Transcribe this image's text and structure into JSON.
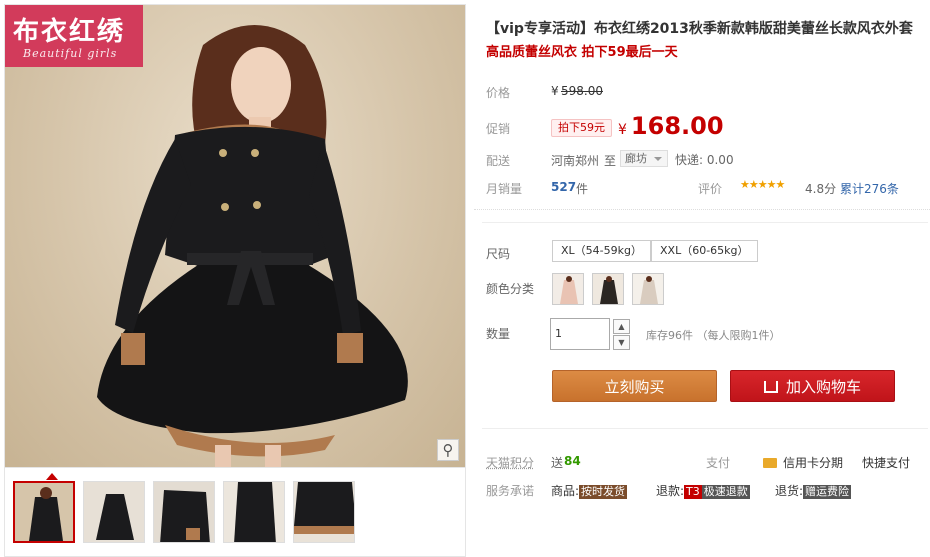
{
  "logo": {
    "cn": "布衣红绣",
    "en": "Beautiful girls"
  },
  "product": {
    "title": "【vip专享活动】布衣红绣2013秋季新款韩版甜美蕾丝长款风衣外套",
    "subtitle": "高品质蕾丝风衣 拍下59最后一天"
  },
  "price": {
    "orig_label": "价格",
    "orig_currency": "¥",
    "orig_value": "598.00",
    "promo_label": "促销",
    "promo_tag": "拍下59元",
    "promo_currency": "¥",
    "promo_value": "168.00"
  },
  "shipping": {
    "label": "配送",
    "from": "河南郑州",
    "to_word": "至",
    "city": "廊坊",
    "express": "快递: 0.00"
  },
  "sales": {
    "label": "月销量",
    "count": "527",
    "unit": "件",
    "rating_label": "评价",
    "stars": "★★★★★",
    "score": "4.8分",
    "total": "累计276条"
  },
  "size": {
    "label": "尺码",
    "options": [
      "XL（54-59kg）",
      "XXL（60-65kg）"
    ]
  },
  "color": {
    "label": "颜色分类",
    "swatches": [
      "#e9c3b3",
      "#2b2622",
      "#d9ccbf"
    ]
  },
  "quantity": {
    "label": "数量",
    "value": "1",
    "stock": "库存96件",
    "limit": "（每人限购1件）"
  },
  "buttons": {
    "buy": "立刻购买",
    "cart": "加入购物车"
  },
  "service": {
    "points_label": "天猫积分",
    "points_prefix": "送",
    "points_value": "84",
    "pay_label": "支付",
    "credit": "信用卡分期",
    "quick": "快捷支付",
    "promise_label": "服务承诺",
    "goods_label": "商品:",
    "goods_tag": "按时发货",
    "refund_label": "退款:",
    "refund_t3": "T3",
    "refund_tag": "极速退款",
    "return_label": "退货:",
    "return_tag": "赠运费险"
  },
  "colors": {
    "accent": "#c40000",
    "buy": "#cd7632",
    "cart": "#c8171c",
    "logo": "#d23b5b"
  }
}
